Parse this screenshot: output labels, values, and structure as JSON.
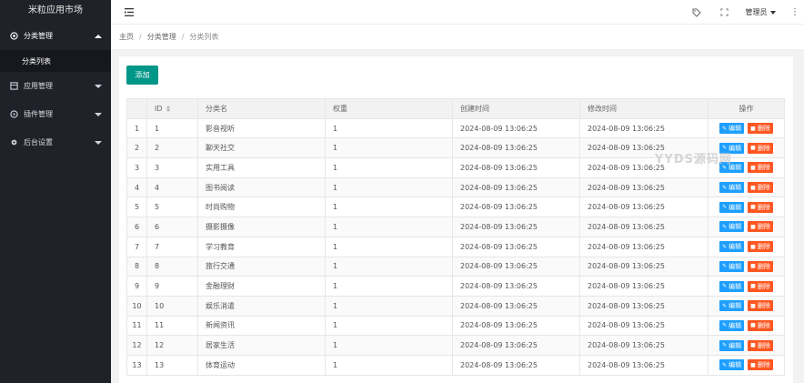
{
  "brand": "米粒应用市场",
  "sidebar": {
    "items": [
      {
        "label": "分类管理",
        "icon": "settings-circle-icon",
        "open": true,
        "sub": [
          {
            "label": "分类列表"
          }
        ]
      },
      {
        "label": "应用管理",
        "icon": "app-icon",
        "open": false
      },
      {
        "label": "插件管理",
        "icon": "plugin-icon",
        "open": false
      },
      {
        "label": "后台设置",
        "icon": "gear-icon",
        "open": false
      }
    ]
  },
  "header": {
    "user": "管理员",
    "icons": [
      "menu-toggle-icon",
      "tag-icon",
      "fullscreen-icon",
      "more-icon"
    ]
  },
  "breadcrumb": [
    "主页",
    "分类管理",
    "分类列表"
  ],
  "toolbar": {
    "add_label": "添加"
  },
  "table": {
    "columns": [
      "",
      "ID",
      "分类名",
      "权重",
      "创建时间",
      "修改时间",
      "操作"
    ],
    "edit_label": "编辑",
    "delete_label": "删除",
    "rows": [
      {
        "idx": "1",
        "id": "1",
        "name": "影音视听",
        "weight": "1",
        "created": "2024-08-09 13:06:25",
        "modified": "2024-08-09 13:06:25"
      },
      {
        "idx": "2",
        "id": "2",
        "name": "聊天社交",
        "weight": "1",
        "created": "2024-08-09 13:06:25",
        "modified": "2024-08-09 13:06:25"
      },
      {
        "idx": "3",
        "id": "3",
        "name": "实用工具",
        "weight": "1",
        "created": "2024-08-09 13:06:25",
        "modified": "2024-08-09 13:06:25"
      },
      {
        "idx": "4",
        "id": "4",
        "name": "图书阅读",
        "weight": "1",
        "created": "2024-08-09 13:06:25",
        "modified": "2024-08-09 13:06:25"
      },
      {
        "idx": "5",
        "id": "5",
        "name": "时尚购物",
        "weight": "1",
        "created": "2024-08-09 13:06:25",
        "modified": "2024-08-09 13:06:25"
      },
      {
        "idx": "6",
        "id": "6",
        "name": "摄影摄像",
        "weight": "1",
        "created": "2024-08-09 13:06:25",
        "modified": "2024-08-09 13:06:25"
      },
      {
        "idx": "7",
        "id": "7",
        "name": "学习教育",
        "weight": "1",
        "created": "2024-08-09 13:06:25",
        "modified": "2024-08-09 13:06:25"
      },
      {
        "idx": "8",
        "id": "8",
        "name": "旅行交通",
        "weight": "1",
        "created": "2024-08-09 13:06:25",
        "modified": "2024-08-09 13:06:25"
      },
      {
        "idx": "9",
        "id": "9",
        "name": "金融理财",
        "weight": "1",
        "created": "2024-08-09 13:06:25",
        "modified": "2024-08-09 13:06:25"
      },
      {
        "idx": "10",
        "id": "10",
        "name": "娱乐消遣",
        "weight": "1",
        "created": "2024-08-09 13:06:25",
        "modified": "2024-08-09 13:06:25"
      },
      {
        "idx": "11",
        "id": "11",
        "name": "新闻资讯",
        "weight": "1",
        "created": "2024-08-09 13:06:25",
        "modified": "2024-08-09 13:06:25"
      },
      {
        "idx": "12",
        "id": "12",
        "name": "居家生活",
        "weight": "1",
        "created": "2024-08-09 13:06:25",
        "modified": "2024-08-09 13:06:25"
      },
      {
        "idx": "13",
        "id": "13",
        "name": "体育运动",
        "weight": "1",
        "created": "2024-08-09 13:06:25",
        "modified": "2024-08-09 13:06:25"
      }
    ]
  },
  "watermark": "YYDS源码网",
  "colors": {
    "sidebar_bg": "#20222a",
    "add": "#009688",
    "edit": "#1e9fff",
    "delete": "#ff5722"
  }
}
